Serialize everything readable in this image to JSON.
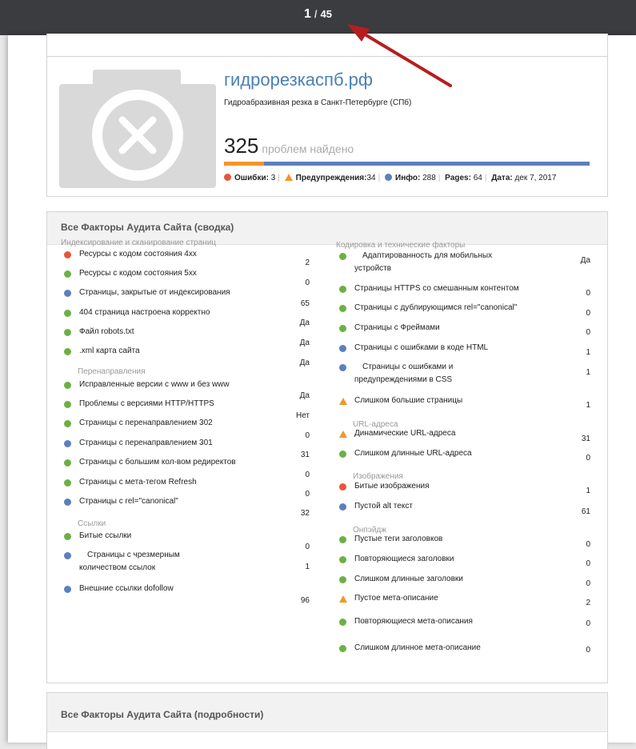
{
  "viewer": {
    "page_current": "1",
    "page_separator": "/",
    "page_total": "45"
  },
  "site": {
    "title": "гидрорезкаспб.рф",
    "subtitle": "Гидроабразивная резка в Санкт-Петербурге (СПб)",
    "problems_count": "325",
    "problems_label": "проблем найдено",
    "problems_bar_fraction": 0.11,
    "errors_label": "Ошибки:",
    "errors_value": "3",
    "warnings_label": "Предупреждения:",
    "warnings_value": "34",
    "info_label": "Инфо:",
    "info_value": "288",
    "pages_label": "Pages:",
    "pages_value": "64",
    "date_label": "Дата:",
    "date_value": "дек 7, 2017"
  },
  "summary": {
    "title": "Все Факторы Аудита Сайта (сводка)",
    "left_sections": [
      {
        "title": "Индексирование и сканирование страниц",
        "items": [
          {
            "status": "err",
            "label": "Ресурсы с кодом состояния 4xx",
            "value": "2"
          },
          {
            "status": "ok",
            "label": "Ресурсы с кодом состояния 5xx",
            "value": "0"
          },
          {
            "status": "info",
            "label": "Страницы, закрытые от индексирования",
            "value": "65"
          },
          {
            "status": "ok",
            "label": "404 страница настроена корректно",
            "value": "Да"
          },
          {
            "status": "ok",
            "label": "Файл robots.txt",
            "value": "Да"
          },
          {
            "status": "ok",
            "label": ".xml карта сайта",
            "value": "Да"
          }
        ]
      },
      {
        "title": "Перенаправления",
        "items": [
          {
            "status": "ok",
            "label": "Исправленные версии с www и без www",
            "value": "Да"
          },
          {
            "status": "ok",
            "label": "Проблемы с версиями HTTP/HTTPS",
            "value": "Нет"
          },
          {
            "status": "ok",
            "label": "Страницы с перенаправлением 302",
            "value": "0"
          },
          {
            "status": "info",
            "label": "Страницы с перенаправлением 301",
            "value": "31"
          },
          {
            "status": "ok",
            "label": "Страницы с большим кол-вом редиректов",
            "value": "0"
          },
          {
            "status": "ok",
            "label": "Страницы с мета-тегом Refresh",
            "value": "0"
          },
          {
            "status": "info",
            "label": "Страницы с rel=\"canonical\"",
            "value": "32"
          }
        ]
      },
      {
        "title": "Ссылки",
        "items": [
          {
            "status": "ok",
            "label": "Битые ссылки",
            "value": "0"
          },
          {
            "status": "info",
            "label": "Страницы с чрезмерным количеством ссылок",
            "value": "1"
          },
          {
            "status": "info",
            "label": "Внешние ссылки dofollow",
            "value": "96"
          }
        ]
      }
    ],
    "right_sections": [
      {
        "title": "Кодировка и технические факторы",
        "items": [
          {
            "status": "ok",
            "label": "Адаптированность для мобильных устройств",
            "value": "Да"
          },
          {
            "status": "ok",
            "label": "Страницы HTTPS со смешанным контентом",
            "value": "0"
          },
          {
            "status": "ok",
            "label": "Страницы с дублирующимся rel=\"canonical\"",
            "value": "0"
          },
          {
            "status": "ok",
            "label": "Страницы с Фреймами",
            "value": "0"
          },
          {
            "status": "info",
            "label": "Страницы с ошибками в коде HTML",
            "value": "1"
          },
          {
            "status": "info",
            "label": "Страницы с ошибками и предупреждениями в CSS",
            "value": "1"
          },
          {
            "status": "warn",
            "label": "Слишком большие страницы",
            "value": "1"
          }
        ]
      },
      {
        "title": "URL-адреса",
        "items": [
          {
            "status": "warn",
            "label": "Динамические URL-адреса",
            "value": "31"
          },
          {
            "status": "ok",
            "label": "Слишком длинные URL-адреса",
            "value": "0"
          }
        ]
      },
      {
        "title": "Изображения",
        "items": [
          {
            "status": "err",
            "label": "Битые изображения",
            "value": "1"
          },
          {
            "status": "info",
            "label": "Пустой alt текст",
            "value": "61"
          }
        ]
      },
      {
        "title": "Онпэйдж",
        "items": [
          {
            "status": "ok",
            "label": "Пустые теги заголовков",
            "value": "0"
          },
          {
            "status": "ok",
            "label": "Повторяющиеся заголовки",
            "value": "0"
          },
          {
            "status": "ok",
            "label": "Слишком длинные заголовки",
            "value": "0"
          },
          {
            "status": "warn",
            "label": "Пустое мета-описание",
            "value": "2"
          },
          {
            "status": "ok",
            "label": "Повторяющиеся мета-описания",
            "value": "0"
          },
          {
            "status": "ok",
            "label": "Слишком длинное мета-описание",
            "value": "0"
          }
        ]
      }
    ]
  },
  "details": {
    "title": "Все Факторы Аудита Сайта (подробности)"
  }
}
